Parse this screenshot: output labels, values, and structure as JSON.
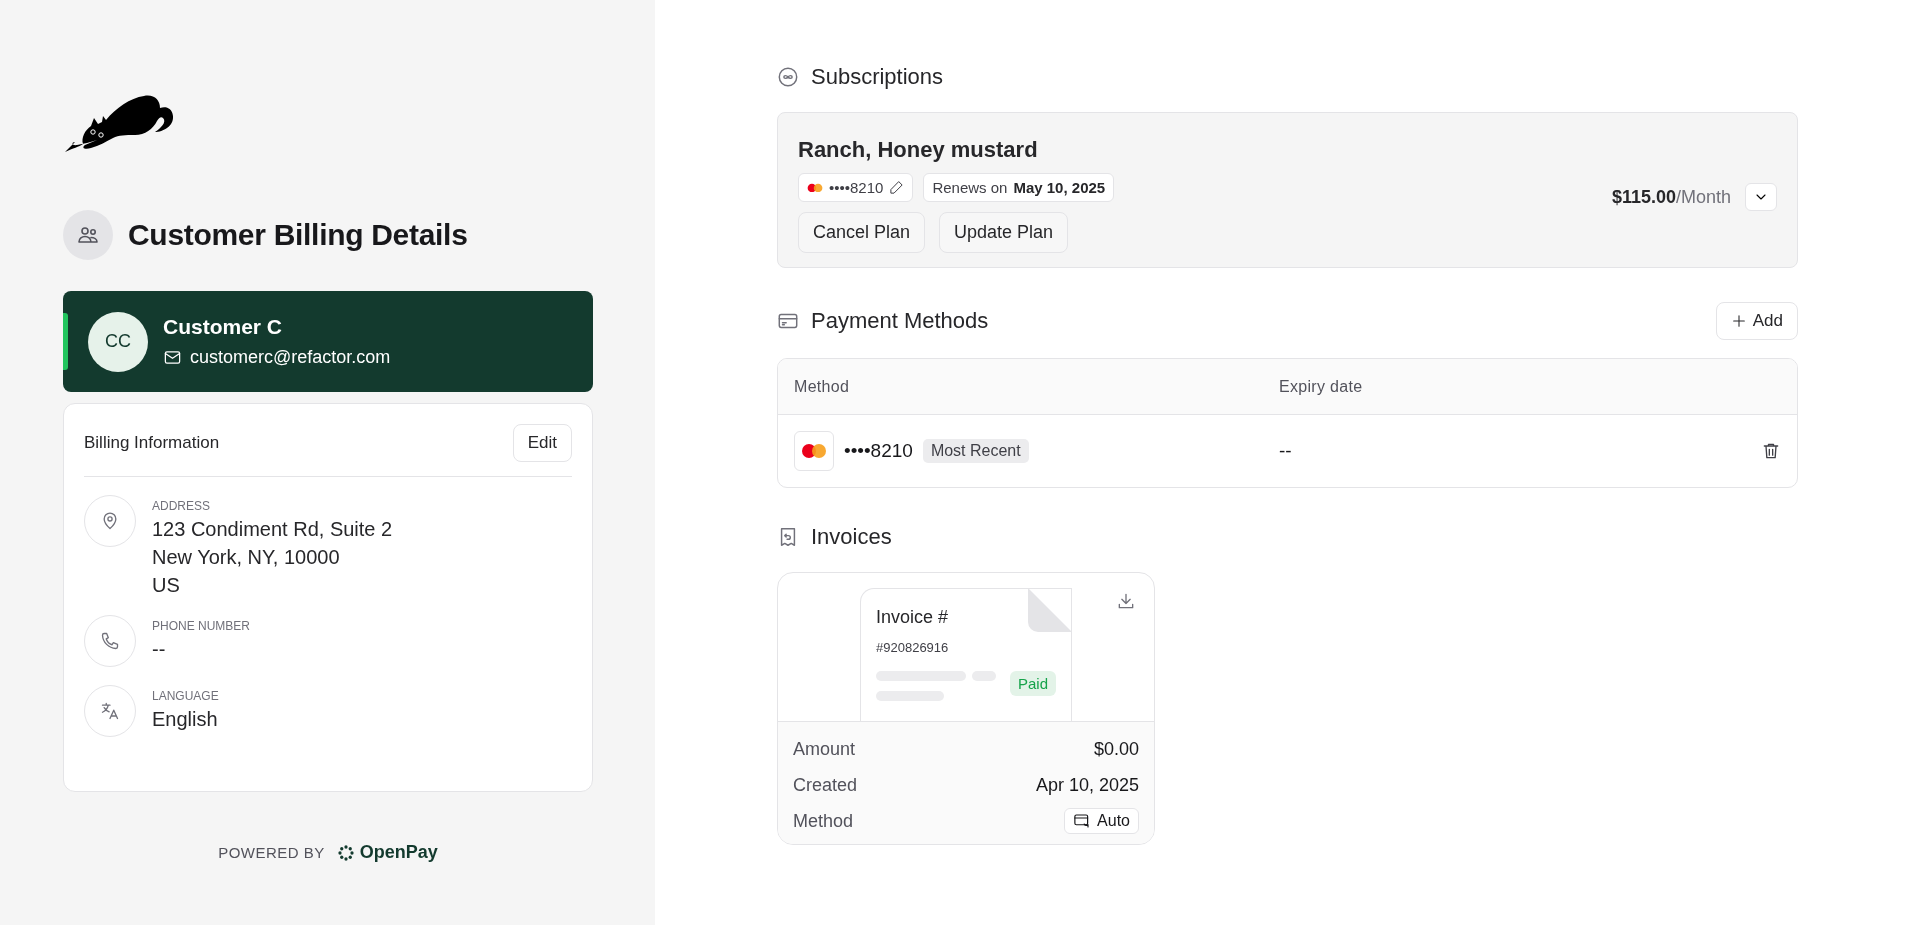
{
  "page_title": "Customer Billing Details",
  "customer": {
    "initials": "CC",
    "name": "Customer C",
    "email": "customerc@refactor.com",
    "selected": true
  },
  "billing": {
    "title": "Billing Information",
    "edit_button": "Edit",
    "fields": [
      {
        "kind": "address",
        "label": "ADDRESS",
        "lines": [
          "123 Condiment Rd, Suite 2",
          "New York, NY, 10000",
          "US"
        ]
      },
      {
        "kind": "phone",
        "label": "PHONE NUMBER",
        "lines": [
          "--"
        ]
      },
      {
        "kind": "language",
        "label": "LANGUAGE",
        "lines": [
          "English"
        ]
      }
    ]
  },
  "powered_by": {
    "label": "POWERED BY",
    "brand": "OpenPay"
  },
  "subscriptions": {
    "title": "Subscriptions",
    "items": [
      {
        "name": "Ranch, Honey mustard",
        "card": "••••8210",
        "renews": "Renews on **May 10, 2025**",
        "price": "$115.00",
        "period": "/Month",
        "expanded": false,
        "buttons": [
          "Cancel Plan",
          "Update Plan"
        ]
      }
    ]
  },
  "payment_methods": {
    "title": "Payment Methods",
    "add_button": "Add",
    "columns": [
      "Method",
      "Expiry date"
    ],
    "rows": [
      {
        "card": "••••8210",
        "badge": "Most Recent",
        "expiry": "--"
      }
    ]
  },
  "invoices": {
    "title": "Invoices",
    "items": [
      {
        "title": "Invoice #",
        "number": "#920826916",
        "status": "Paid",
        "details": [
          {
            "kind": "text",
            "label": "Amount",
            "value": "$0.00"
          },
          {
            "kind": "text",
            "label": "Created",
            "value": "Apr 10, 2025"
          },
          {
            "kind": "badge",
            "label": "Method",
            "value": "Auto"
          }
        ]
      }
    ]
  }
}
